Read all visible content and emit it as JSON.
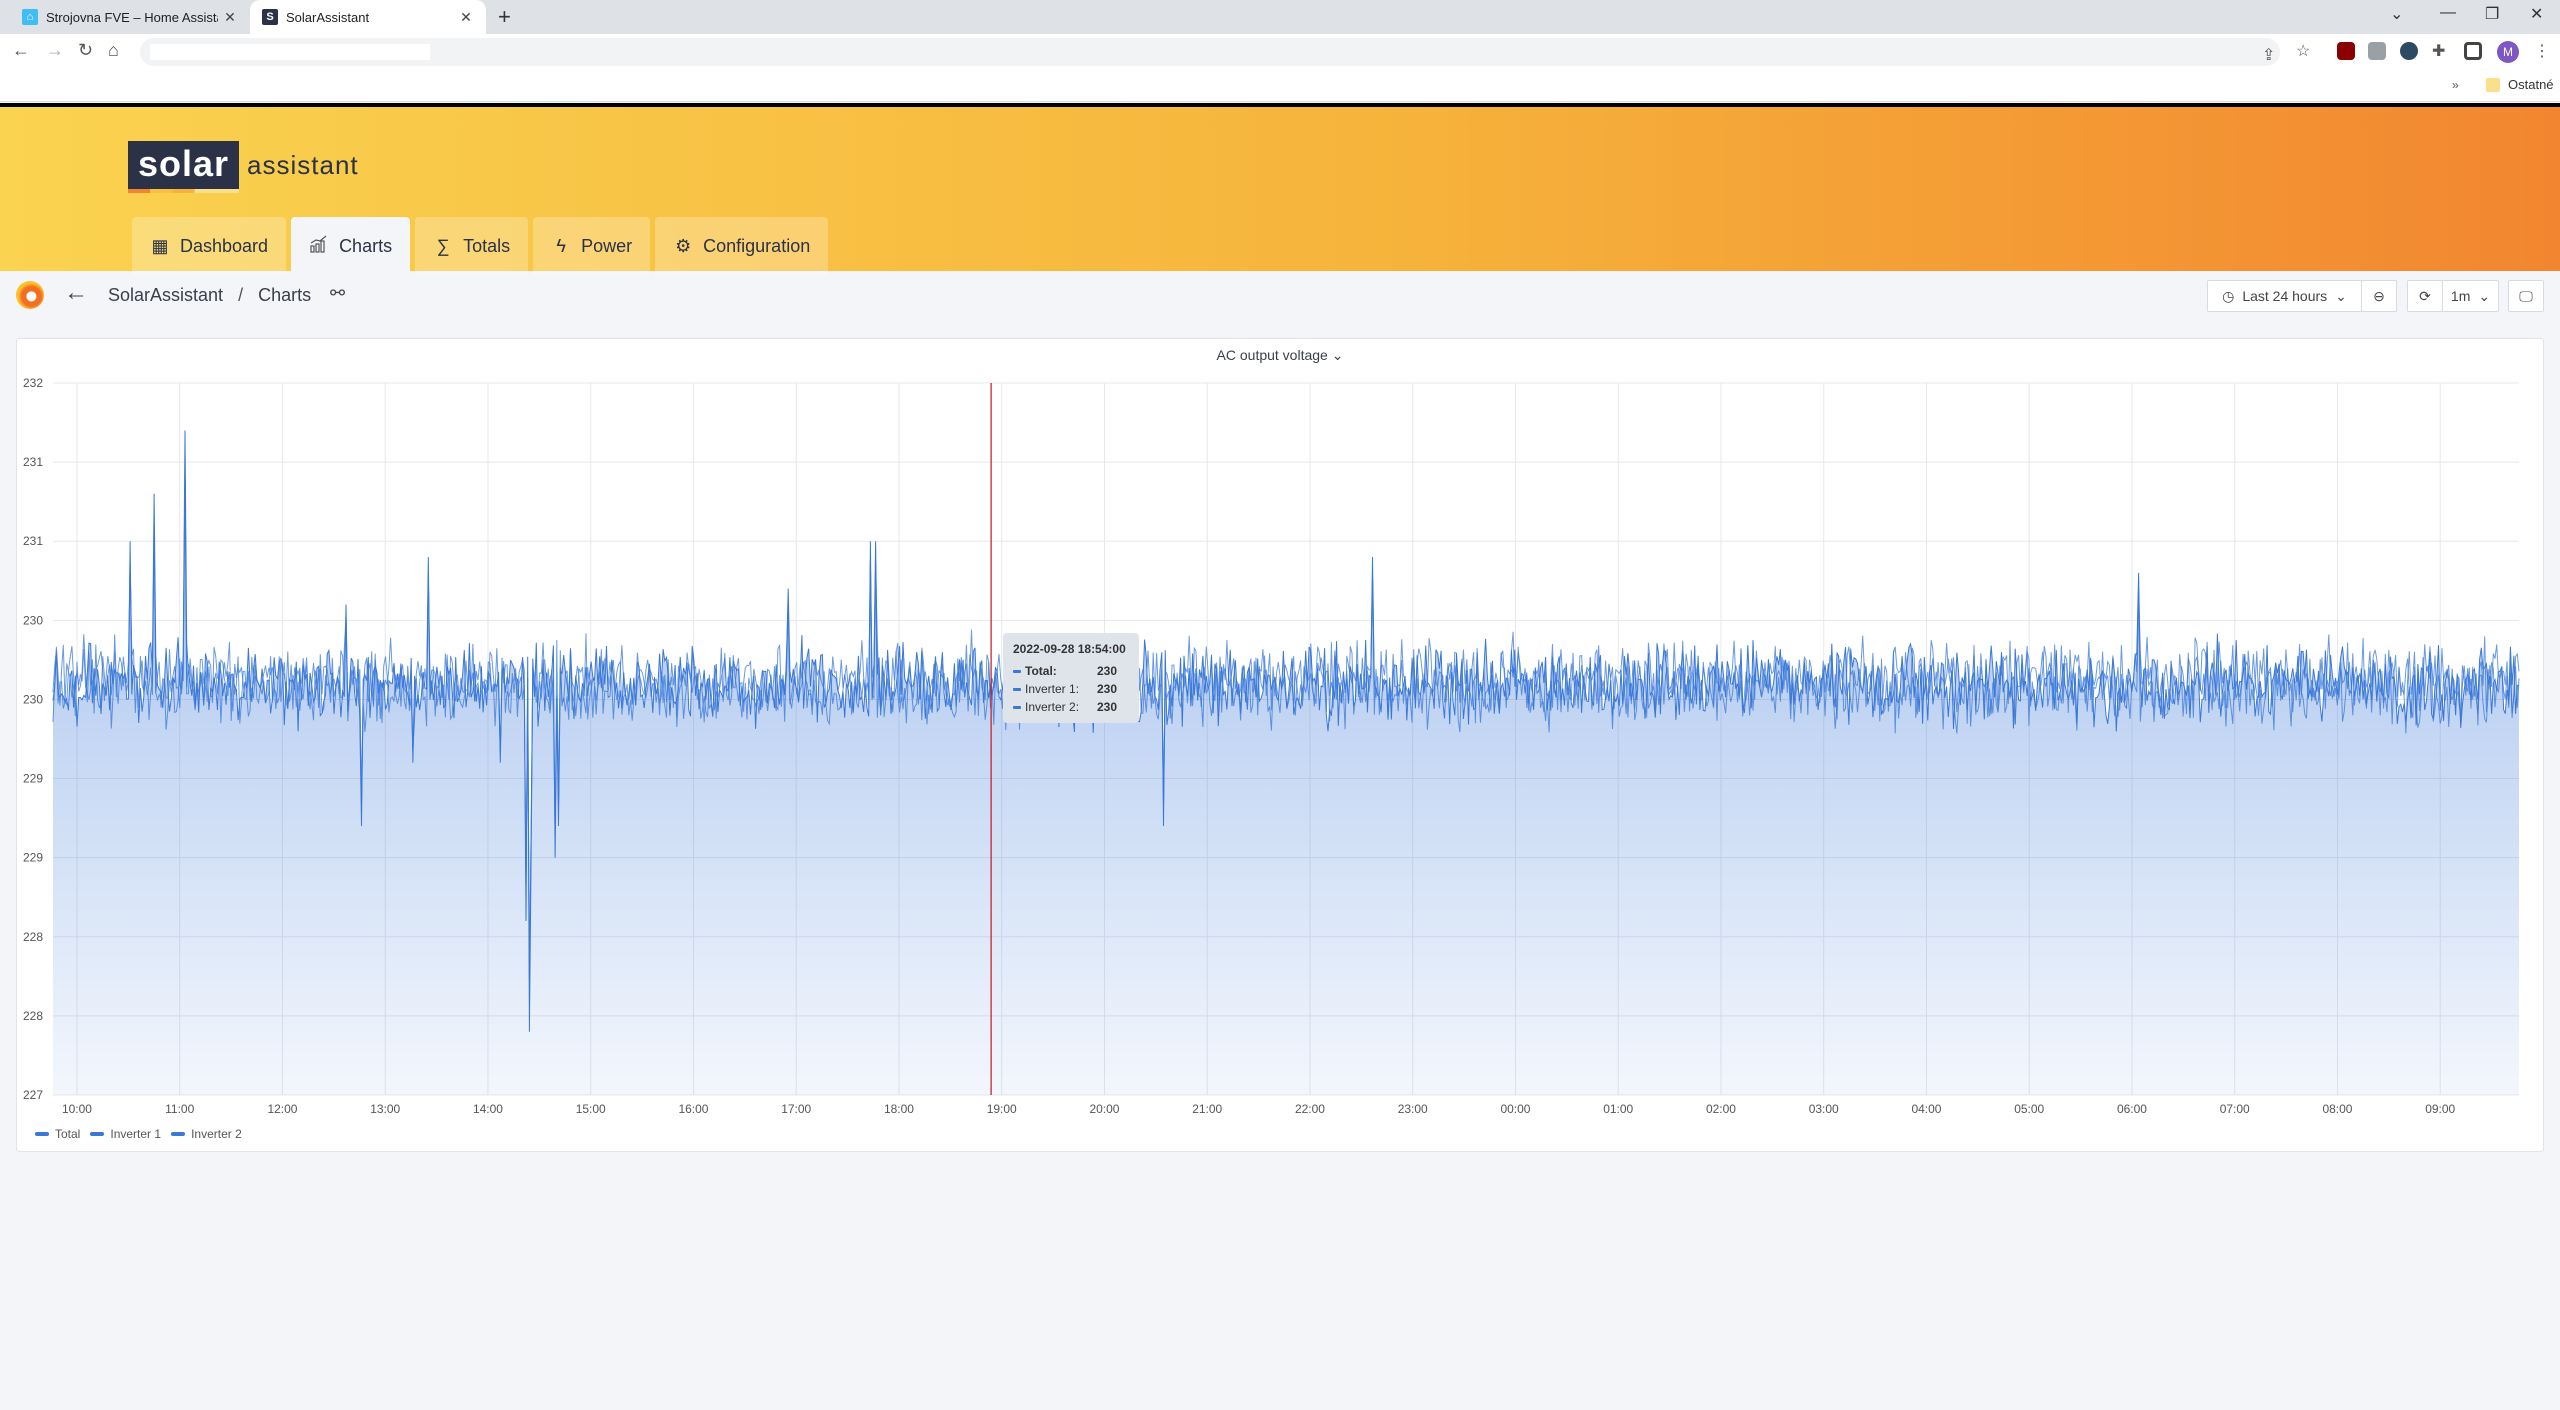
{
  "browser": {
    "tabs": [
      {
        "title": "Strojovna FVE – Home Assistant",
        "favicon": "home-assistant-icon",
        "active": false
      },
      {
        "title": "SolarAssistant",
        "favicon": "solar-assistant-icon",
        "favicon_letter": "S",
        "active": true
      }
    ],
    "close_glyph": "✕",
    "new_tab_glyph": "+",
    "bookmarks": {
      "more_glyph": "»",
      "folder_label": "Ostatné"
    },
    "avatar_letter": "M"
  },
  "app": {
    "logo_box": "solar",
    "logo_word": "assistant",
    "nav": [
      {
        "label": "Dashboard",
        "icon": "grid-icon",
        "glyph": "▦",
        "active": false
      },
      {
        "label": "Charts",
        "icon": "chart-icon",
        "glyph": "📈",
        "active": true
      },
      {
        "label": "Totals",
        "icon": "sigma-icon",
        "glyph": "∑",
        "active": false
      },
      {
        "label": "Power",
        "icon": "bolt-icon",
        "glyph": "ϟ",
        "active": false
      },
      {
        "label": "Configuration",
        "icon": "gear-icon",
        "glyph": "⚙",
        "active": false
      }
    ]
  },
  "grafana": {
    "breadcrumb": [
      "SolarAssistant",
      "Charts"
    ],
    "breadcrumb_sep": "/",
    "time_range": "Last 24 hours",
    "refresh_interval": "1m"
  },
  "panel": {
    "title": "AC output voltage",
    "tooltip": {
      "time": "2022-09-28 18:54:00",
      "rows": [
        {
          "name": "Total:",
          "value": "230"
        },
        {
          "name": "Inverter 1:",
          "value": "230"
        },
        {
          "name": "Inverter 2:",
          "value": "230"
        }
      ]
    }
  },
  "chart_data": {
    "type": "area",
    "title": "AC output voltage",
    "xlabel": "",
    "ylabel": "",
    "x_start": "09:46",
    "x_end": "09:46 (+1 day)",
    "x_tick_labels": [
      "10:00",
      "11:00",
      "12:00",
      "13:00",
      "14:00",
      "15:00",
      "16:00",
      "17:00",
      "18:00",
      "19:00",
      "20:00",
      "21:00",
      "22:00",
      "23:00",
      "00:00",
      "01:00",
      "02:00",
      "03:00",
      "04:00",
      "05:00",
      "06:00",
      "07:00",
      "08:00",
      "09:00"
    ],
    "y_tick_values": [
      232,
      231.5,
      231,
      230.5,
      230,
      229.5,
      229,
      228.5,
      228,
      227.5
    ],
    "y_tick_labels": [
      "232",
      "231",
      "231",
      "230",
      "230",
      "229",
      "229",
      "228",
      "228",
      "227"
    ],
    "ylim": [
      227.5,
      232
    ],
    "grid": true,
    "legend_position": "bottom-left",
    "cursor_time_hours_from_start": 9.13,
    "series": [
      {
        "name": "Total",
        "color": "#3a78d8",
        "baseline": 230.1,
        "noise_amplitude": 0.12
      },
      {
        "name": "Inverter 1",
        "color": "#3a78d8",
        "baseline": 230.1,
        "noise_amplitude": 0.12
      },
      {
        "name": "Inverter 2",
        "color": "#3a78d8",
        "baseline": 230.1,
        "noise_amplitude": 0.12
      }
    ],
    "notable_points": [
      {
        "t_hours": 0.75,
        "value": 231.0
      },
      {
        "t_hours": 0.98,
        "value": 231.3
      },
      {
        "t_hours": 1.28,
        "value": 231.7
      },
      {
        "t_hours": 2.85,
        "value": 230.6
      },
      {
        "t_hours": 3.0,
        "value": 229.2
      },
      {
        "t_hours": 3.5,
        "value": 229.6
      },
      {
        "t_hours": 3.65,
        "value": 230.9
      },
      {
        "t_hours": 4.35,
        "value": 229.6
      },
      {
        "t_hours": 4.6,
        "value": 228.6
      },
      {
        "t_hours": 4.63,
        "value": 227.9
      },
      {
        "t_hours": 4.65,
        "value": 229.0
      },
      {
        "t_hours": 4.88,
        "value": 229.0
      },
      {
        "t_hours": 4.92,
        "value": 229.2
      },
      {
        "t_hours": 7.15,
        "value": 230.7
      },
      {
        "t_hours": 7.95,
        "value": 231.0
      },
      {
        "t_hours": 8.0,
        "value": 231.0
      },
      {
        "t_hours": 8.05,
        "value": 229.9
      },
      {
        "t_hours": 10.8,
        "value": 229.2
      },
      {
        "t_hours": 12.85,
        "value": 230.9
      },
      {
        "t_hours": 20.3,
        "value": 230.8
      }
    ]
  }
}
